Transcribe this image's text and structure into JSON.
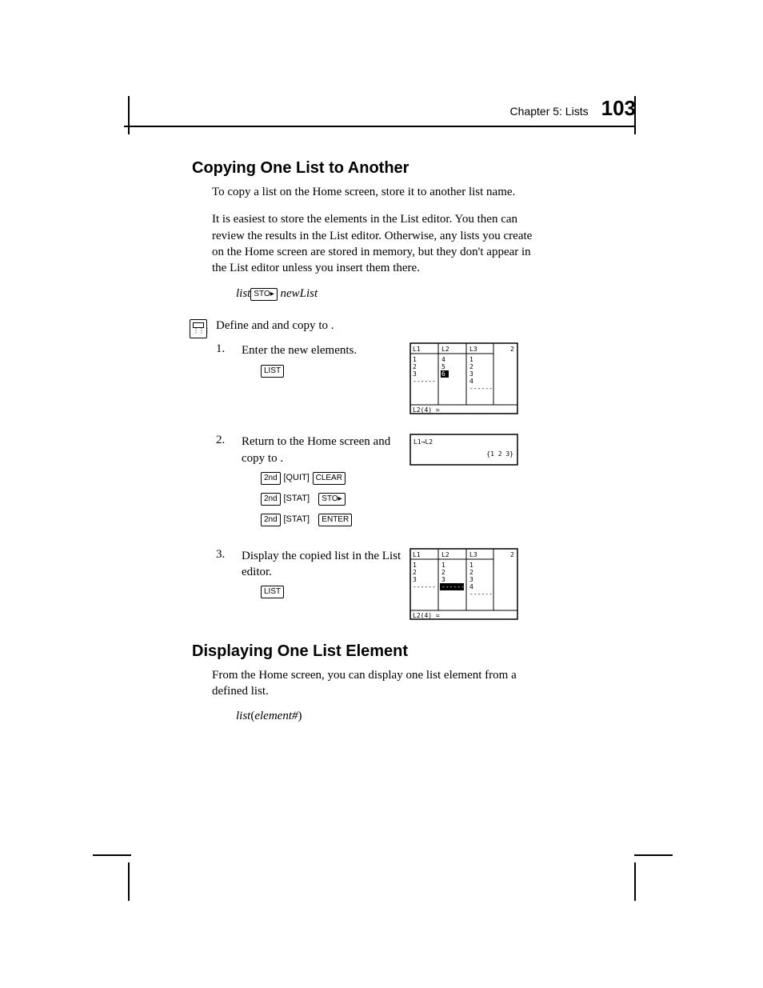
{
  "header": {
    "chapter": "Chapter 5: Lists",
    "page": "103"
  },
  "section1": {
    "title": "Copying One List to Another",
    "p1": "To copy a list on the Home screen, store it to another list name.",
    "p2": "It is easiest to store the elements in the List editor. You then can review the results in the List editor. Otherwise, any lists you create on the Home screen are stored in memory, but they don't appear in the List editor unless you insert them there.",
    "syntax_list": "list",
    "syntax_sto": "STO▸",
    "syntax_newlist": " newList"
  },
  "example": {
    "intro_prefix": "Define ",
    "intro_mid": " and ",
    "intro_mid2": " and copy ",
    "intro_to": " to ",
    "intro_end": ".",
    "step1": {
      "num": "1.",
      "text": "Enter the new elements.",
      "key1": "LIST"
    },
    "step2": {
      "num": "2.",
      "text1": "Return to the Home screen and copy ",
      "text_to": " to ",
      "text_end": ".",
      "r1k1": "2nd",
      "r1k2": "QUIT",
      "r1k3": "CLEAR",
      "r2k1": "2nd",
      "r2k2": "STAT",
      "r2k3": "STO▸",
      "r3k1": "2nd",
      "r3k2": "STAT",
      "r3k3": "ENTER"
    },
    "step3": {
      "num": "3.",
      "text": "Display the copied list in the List editor.",
      "key1": "LIST"
    }
  },
  "section2": {
    "title": "Displaying One List Element",
    "p1": "From the Home screen, you can display one list element from a defined list.",
    "syntax_list": "list",
    "syntax_open": "(",
    "syntax_elem": "element#",
    "syntax_close": ")"
  },
  "figs": {
    "f1": {
      "L1": "L1",
      "L2": "L2",
      "L3": "L3",
      "two": "2",
      "c1": [
        "1",
        "2",
        "3"
      ],
      "c2": [
        "4",
        "5",
        "6"
      ],
      "c3": [
        "1",
        "2",
        "3",
        "4"
      ],
      "status": "L2(4) ="
    },
    "f2": {
      "expr": "L1→L2",
      "result": "{1 2 3}"
    },
    "f3": {
      "L1": "L1",
      "L2": "L2",
      "L3": "L3",
      "two": "2",
      "c1": [
        "1",
        "2",
        "3"
      ],
      "c2": [
        "1",
        "2",
        "3"
      ],
      "c3": [
        "1",
        "2",
        "3",
        "4"
      ],
      "status": "L2(4) ="
    }
  }
}
